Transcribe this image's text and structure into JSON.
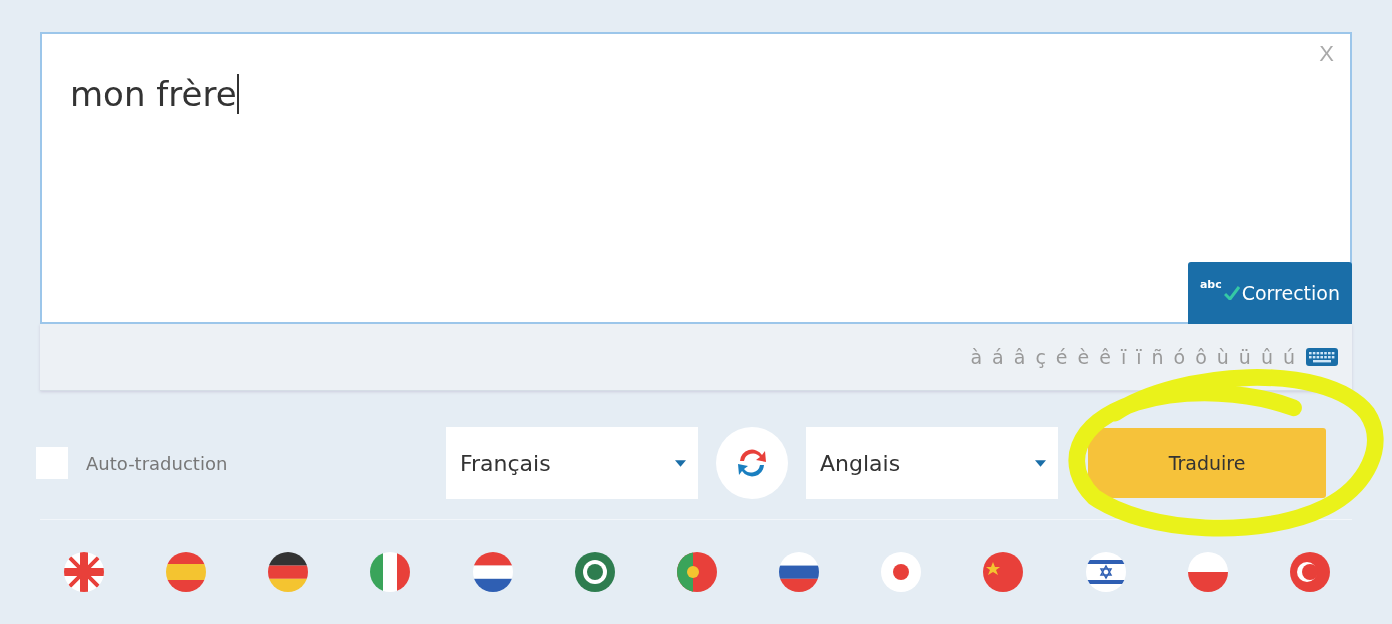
{
  "source": {
    "value": "mon frère",
    "clear": "X"
  },
  "correction": {
    "badge": "abc",
    "label": "Correction"
  },
  "accents": [
    "à",
    "á",
    "â",
    "ç",
    "é",
    "è",
    "ê",
    "ï",
    "ï",
    "ñ",
    "ó",
    "ô",
    "ù",
    "ü",
    "û",
    "ú"
  ],
  "auto_translate": {
    "label": "Auto-traduction",
    "checked": false
  },
  "source_language": "Français",
  "target_language": "Anglais",
  "translate_button": "Traduire"
}
